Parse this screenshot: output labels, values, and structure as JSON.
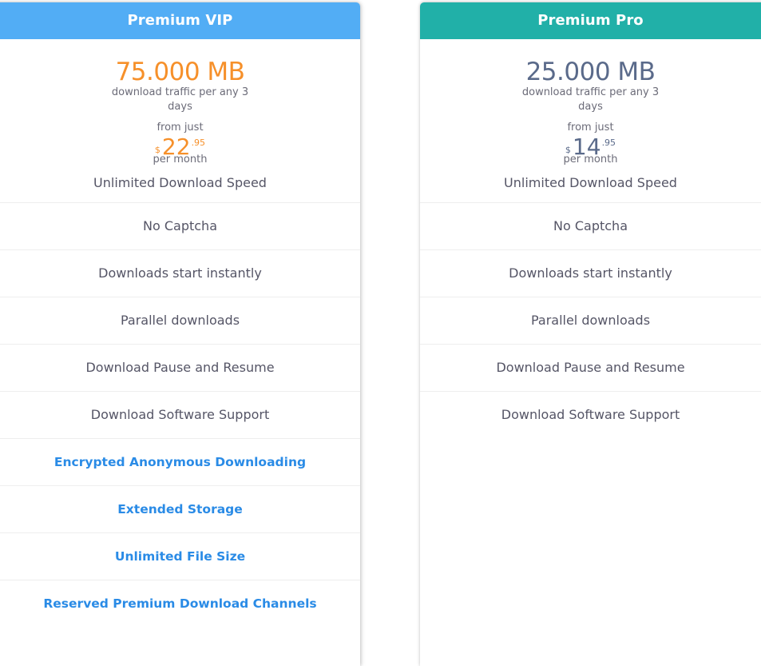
{
  "plans": [
    {
      "id": "vip",
      "title": "Premium VIP",
      "header_color": "#52adf5",
      "accent_color": "#f6902a",
      "traffic": "75.000 MB",
      "traffic_desc": "download traffic per any 3 days",
      "from_label": "from just",
      "price_currency": "$",
      "price_integer": "22",
      "price_decimal": ".95",
      "period_label": "per month",
      "features": [
        {
          "label": "Unlimited Download Speed",
          "highlight": false
        },
        {
          "label": "No Captcha",
          "highlight": false
        },
        {
          "label": "Downloads start instantly",
          "highlight": false
        },
        {
          "label": "Parallel downloads",
          "highlight": false
        },
        {
          "label": "Download Pause and Resume",
          "highlight": false
        },
        {
          "label": "Download Software Support",
          "highlight": false
        },
        {
          "label": "Encrypted Anonymous Downloading",
          "highlight": true
        },
        {
          "label": "Extended Storage",
          "highlight": true
        },
        {
          "label": "Unlimited File Size",
          "highlight": true
        },
        {
          "label": "Reserved Premium Download Channels",
          "highlight": true
        }
      ]
    },
    {
      "id": "pro",
      "title": "Premium Pro",
      "header_color": "#21b0a8",
      "accent_color": "#5a6a8a",
      "traffic": "25.000 MB",
      "traffic_desc": "download traffic per any 3 days",
      "from_label": "from just",
      "price_currency": "$",
      "price_integer": "14",
      "price_decimal": ".95",
      "period_label": "per month",
      "features": [
        {
          "label": "Unlimited Download Speed",
          "highlight": false
        },
        {
          "label": "No Captcha",
          "highlight": false
        },
        {
          "label": "Downloads start instantly",
          "highlight": false
        },
        {
          "label": "Parallel downloads",
          "highlight": false
        },
        {
          "label": "Download Pause and Resume",
          "highlight": false
        },
        {
          "label": "Download Software Support",
          "highlight": false
        }
      ]
    }
  ]
}
